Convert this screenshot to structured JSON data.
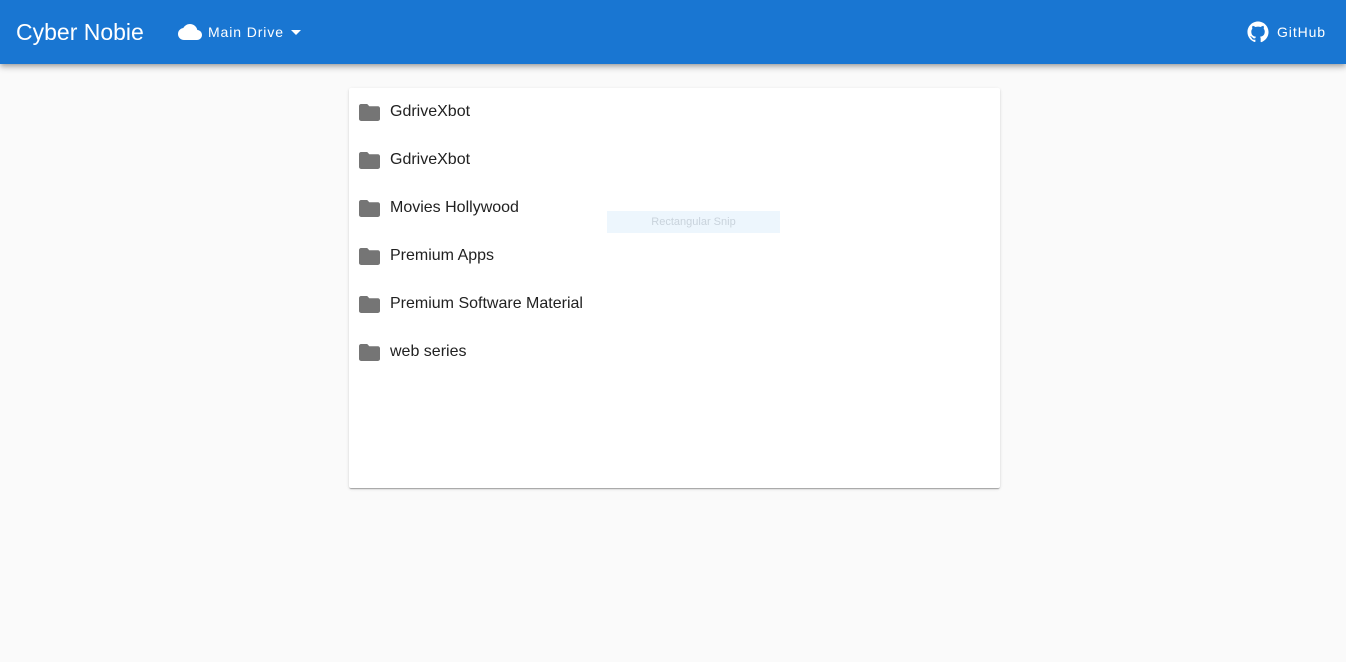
{
  "appbar": {
    "title": "Cyber Nobie",
    "drive_label": "Main Drive",
    "github_label": "GitHub",
    "color": "#1976d2"
  },
  "files": {
    "items": [
      {
        "name": "GdriveXbot",
        "icon": "folder-icon"
      },
      {
        "name": "GdriveXbot",
        "icon": "folder-icon"
      },
      {
        "name": "Movies Hollywood",
        "icon": "folder-icon"
      },
      {
        "name": "Premium Apps",
        "icon": "folder-icon"
      },
      {
        "name": "Premium Software Material",
        "icon": "folder-icon"
      },
      {
        "name": "web series",
        "icon": "folder-icon"
      }
    ]
  },
  "overlay": {
    "snip_label": "Rectangular Snip"
  }
}
